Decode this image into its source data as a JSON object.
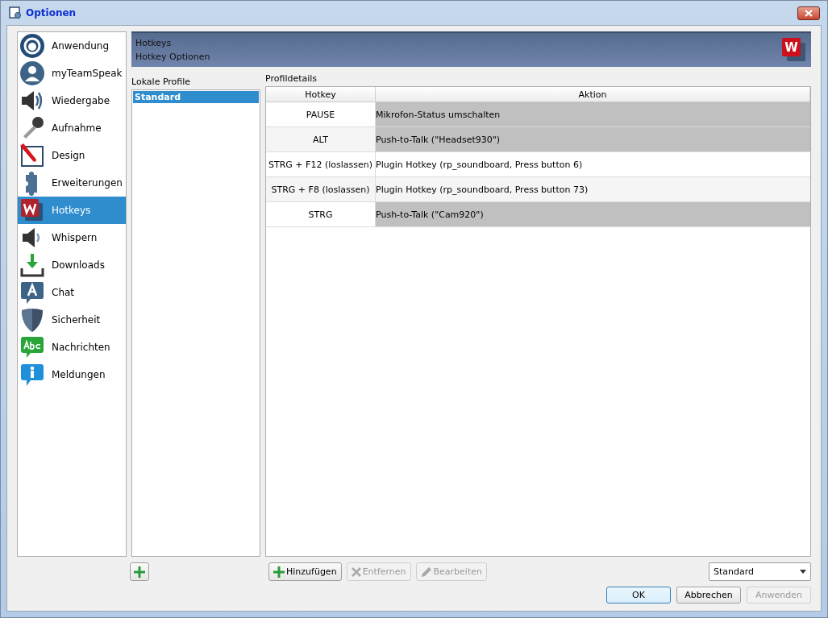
{
  "window": {
    "title": "Optionen"
  },
  "sidebar": {
    "items": [
      {
        "label": "Anwendung",
        "selected": false
      },
      {
        "label": "myTeamSpeak",
        "selected": false
      },
      {
        "label": "Wiedergabe",
        "selected": false
      },
      {
        "label": "Aufnahme",
        "selected": false
      },
      {
        "label": "Design",
        "selected": false
      },
      {
        "label": "Erweiterungen",
        "selected": false
      },
      {
        "label": "Hotkeys",
        "selected": true
      },
      {
        "label": "Whispern",
        "selected": false
      },
      {
        "label": "Downloads",
        "selected": false
      },
      {
        "label": "Chat",
        "selected": false
      },
      {
        "label": "Sicherheit",
        "selected": false
      },
      {
        "label": "Nachrichten",
        "selected": false
      },
      {
        "label": "Meldungen",
        "selected": false
      }
    ]
  },
  "header": {
    "title": "Hotkeys",
    "subtitle": "Hotkey Optionen",
    "logo_letter": "W"
  },
  "profiles": {
    "label": "Lokale Profile",
    "items": [
      {
        "label": "Standard",
        "selected": true
      }
    ]
  },
  "details": {
    "label": "Profildetails",
    "columns": [
      "Hotkey",
      "Aktion"
    ],
    "rows": [
      {
        "hotkey": "PAUSE",
        "action": "Mikrofon-Status umschalten",
        "selected": true
      },
      {
        "hotkey": "ALT",
        "action": "Push-to-Talk (\"Headset930\")",
        "selected": true
      },
      {
        "hotkey": "STRG + F12 (loslassen)",
        "action": "Plugin Hotkey (rp_soundboard, Press button 6)",
        "selected": false
      },
      {
        "hotkey": "STRG + F8 (loslassen)",
        "action": "Plugin Hotkey (rp_soundboard, Press button 73)",
        "selected": false
      },
      {
        "hotkey": "STRG",
        "action": "Push-to-Talk (\"Cam920\")",
        "selected": true
      }
    ]
  },
  "table_buttons": [
    {
      "label": "Hinzufügen",
      "disabled": false
    },
    {
      "label": "Entfernen",
      "disabled": true
    },
    {
      "label": "Bearbeiten",
      "disabled": true
    }
  ],
  "profile_select": {
    "value": "Standard"
  },
  "dialog_buttons": [
    {
      "label": "OK",
      "disabled": false,
      "default": true
    },
    {
      "label": "Abbrechen",
      "disabled": false,
      "default": false
    },
    {
      "label": "Anwenden",
      "disabled": true,
      "default": false
    }
  ]
}
